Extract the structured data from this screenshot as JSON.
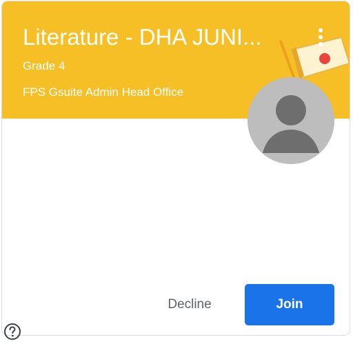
{
  "class_card": {
    "title": "Literature - DHA JUNI...",
    "section": "Grade 4",
    "owner": "FPS Gsuite Admin Head Office",
    "theme_color": "#f6bf26"
  },
  "actions": {
    "decline_label": "Decline",
    "join_label": "Join",
    "join_color": "#1a73e8"
  },
  "icons": {
    "more": "more-vert-icon",
    "avatar": "default-avatar-icon",
    "help": "help-circle-icon"
  }
}
